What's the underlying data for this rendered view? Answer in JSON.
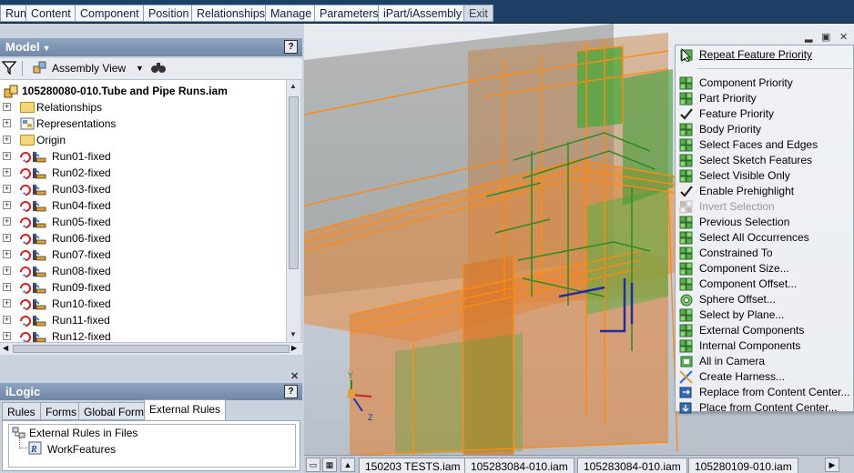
{
  "ribbon": {
    "tabs": [
      "Run",
      "Content",
      "Component",
      "Position",
      "Relationships",
      "Manage",
      "Parameters",
      "iPart/iAssembly",
      "Exit"
    ]
  },
  "model_panel": {
    "title": "Model",
    "view_label": "Assembly View",
    "help": "?",
    "root": "105280080-010.Tube and Pipe Runs.iam",
    "nodes": [
      {
        "label": "Relationships",
        "icon": "folder-icon"
      },
      {
        "label": "Representations",
        "icon": "representations-icon"
      },
      {
        "label": "Origin",
        "icon": "folder-icon"
      },
      {
        "label": "Run01-fixed",
        "icon": "run-icon"
      },
      {
        "label": "Run02-fixed",
        "icon": "run-icon"
      },
      {
        "label": "Run03-fixed",
        "icon": "run-icon"
      },
      {
        "label": "Run04-fixed",
        "icon": "run-icon"
      },
      {
        "label": "Run05-fixed",
        "icon": "run-icon"
      },
      {
        "label": "Run06-fixed",
        "icon": "run-icon"
      },
      {
        "label": "Run07-fixed",
        "icon": "run-icon"
      },
      {
        "label": "Run08-fixed",
        "icon": "run-icon"
      },
      {
        "label": "Run09-fixed",
        "icon": "run-icon"
      },
      {
        "label": "Run10-fixed",
        "icon": "run-icon"
      },
      {
        "label": "Run11-fixed",
        "icon": "run-icon"
      },
      {
        "label": "Run12-fixed",
        "icon": "run-icon"
      }
    ]
  },
  "ilogic_panel": {
    "title": "iLogic",
    "help": "?",
    "tabs": [
      "Rules",
      "Forms",
      "Global Forms",
      "External Rules"
    ],
    "active_tab": "External Rules",
    "tree": {
      "root": "External Rules in Files",
      "child": "WorkFeatures"
    }
  },
  "context_menu": {
    "items": [
      {
        "label": "Repeat Feature Priority",
        "icon": "cursor-icon",
        "enabled": true
      },
      {
        "label": "Component Priority",
        "icon": "component-priority-icon",
        "enabled": true
      },
      {
        "label": "Part Priority",
        "icon": "part-priority-icon",
        "enabled": true
      },
      {
        "label": "Feature Priority",
        "icon": "checkmark-icon",
        "enabled": true
      },
      {
        "label": "Body Priority",
        "icon": "body-priority-icon",
        "enabled": true
      },
      {
        "label": "Select Faces and Edges",
        "icon": "faces-edges-icon",
        "enabled": true
      },
      {
        "label": "Select Sketch Features",
        "icon": "sketch-features-icon",
        "enabled": true
      },
      {
        "label": "Select Visible Only",
        "icon": "visible-only-icon",
        "enabled": true
      },
      {
        "label": "Enable Prehighlight",
        "icon": "checkmark-icon",
        "enabled": true
      },
      {
        "label": "Invert Selection",
        "icon": "invert-selection-icon",
        "enabled": false
      },
      {
        "label": "Previous Selection",
        "icon": "previous-selection-icon",
        "enabled": true
      },
      {
        "label": "Select All Occurrences",
        "icon": "all-occurrences-icon",
        "enabled": true
      },
      {
        "label": "Constrained To",
        "icon": "constrained-to-icon",
        "enabled": true
      },
      {
        "label": "Component Size...",
        "icon": "component-size-icon",
        "enabled": true
      },
      {
        "label": "Component Offset...",
        "icon": "component-offset-icon",
        "enabled": true
      },
      {
        "label": "Sphere Offset...",
        "icon": "sphere-offset-icon",
        "enabled": true
      },
      {
        "label": "Select by Plane...",
        "icon": "select-by-plane-icon",
        "enabled": true
      },
      {
        "label": "External Components",
        "icon": "external-components-icon",
        "enabled": true
      },
      {
        "label": "Internal Components",
        "icon": "internal-components-icon",
        "enabled": true
      },
      {
        "label": "All in Camera",
        "icon": "all-in-camera-icon",
        "enabled": true
      },
      {
        "label": "Create Harness...",
        "icon": "create-harness-icon",
        "enabled": true
      },
      {
        "label": "Replace from Content Center...",
        "icon": "replace-content-center-icon",
        "enabled": true
      },
      {
        "label": "Place from Content Center...",
        "icon": "place-content-center-icon",
        "enabled": true
      }
    ]
  },
  "document_tabs": [
    "150203 TESTS.iam",
    "105283084-010.iam",
    "105283084-010.iam",
    "105280109-010.iam"
  ],
  "colors": {
    "accent_orange": "#f07a10",
    "accent_green": "#3aa52a",
    "ribbon_bg": "#1e3f66"
  }
}
